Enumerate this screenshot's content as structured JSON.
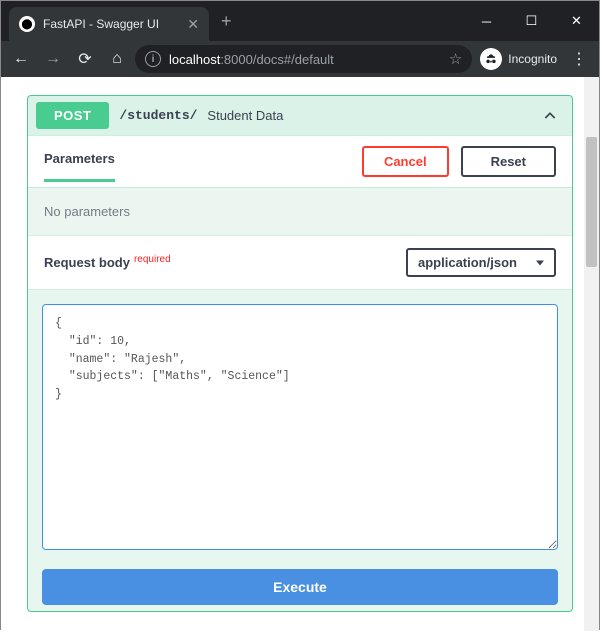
{
  "browser": {
    "tab_title": "FastAPI - Swagger UI",
    "url_host": "localhost",
    "url_port_path": ":8000/docs#/default",
    "incognito_label": "Incognito"
  },
  "op": {
    "method": "POST",
    "path": "/students/",
    "description": "Student Data"
  },
  "sections": {
    "parameters_label": "Parameters",
    "cancel_label": "Cancel",
    "reset_label": "Reset",
    "no_parameters": "No parameters",
    "request_body_label": "Request body",
    "required_tag": "required",
    "content_type": "application/json"
  },
  "request_body_value": "{\n  \"id\": 10,\n  \"name\": \"Rajesh\",\n  \"subjects\": [\"Maths\", \"Science\"]\n}",
  "actions": {
    "execute_label": "Execute"
  }
}
